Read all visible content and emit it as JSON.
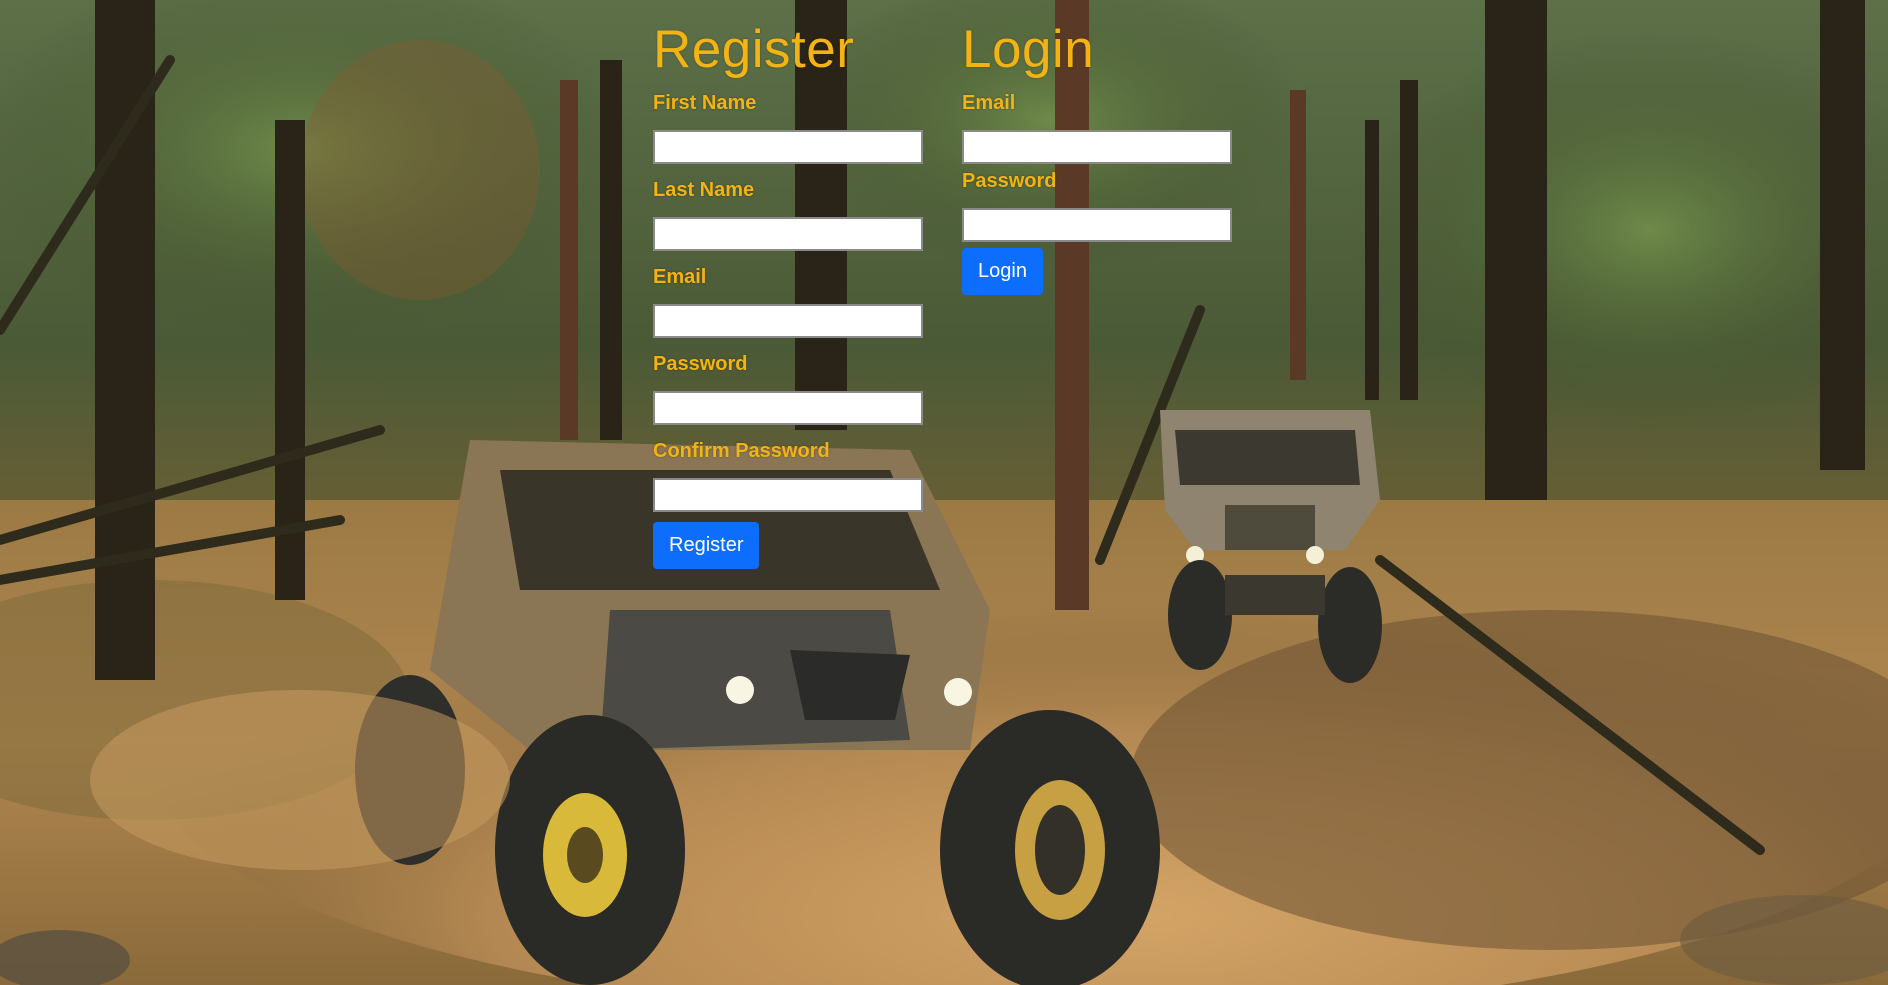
{
  "register": {
    "title": "Register",
    "fields": [
      {
        "label": "First Name",
        "value": ""
      },
      {
        "label": "Last Name",
        "value": ""
      },
      {
        "label": "Email",
        "value": ""
      },
      {
        "label": "Password",
        "value": ""
      },
      {
        "label": "Confirm Password",
        "value": ""
      }
    ],
    "button_label": "Register"
  },
  "login": {
    "title": "Login",
    "fields": [
      {
        "label": "Email",
        "value": ""
      },
      {
        "label": "Password",
        "value": ""
      }
    ],
    "button_label": "Login"
  },
  "colors": {
    "heading": "#f3b313",
    "button": "#0d6efd",
    "button_text": "#ffffff"
  },
  "background": {
    "image": "forest-trail-offroad-buggies"
  }
}
